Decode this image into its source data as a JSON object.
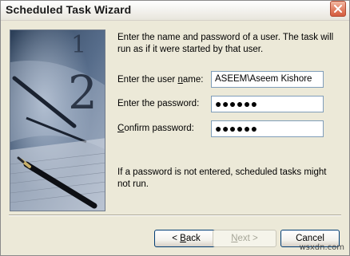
{
  "window": {
    "title": "Scheduled Task Wizard"
  },
  "intro_text": "Enter the name and password of a user.  The task will run as if it were started by that user.",
  "fields": {
    "user_name": {
      "label_pre": "Enter the user ",
      "label_ul": "n",
      "label_post": "ame:",
      "value": "ASEEM\\Aseem Kishore"
    },
    "password": {
      "label": "Enter the password:",
      "value": "●●●●●●"
    },
    "confirm": {
      "label_ul": "C",
      "label_post": "onfirm password:",
      "value": "●●●●●●"
    }
  },
  "note_text": "If a password is not entered, scheduled tasks might not run.",
  "buttons": {
    "back": {
      "prefix": "< ",
      "ul": "B",
      "rest": "ack"
    },
    "next": {
      "ul": "N",
      "rest": "ext >"
    },
    "cancel": "Cancel"
  },
  "watermark": "wsxdn.com",
  "colors": {
    "accent": "#003c74",
    "close": "#d45c3f"
  }
}
